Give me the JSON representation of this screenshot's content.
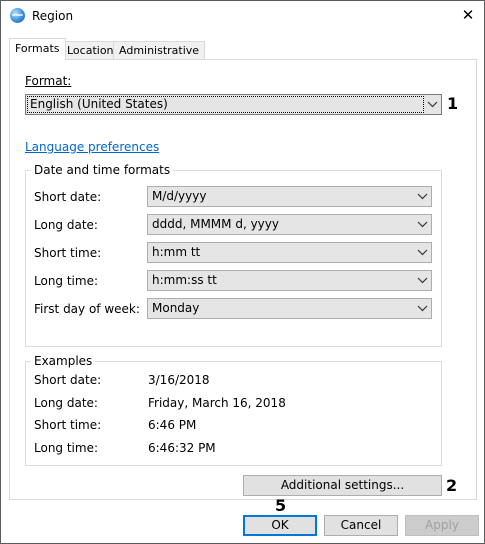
{
  "window": {
    "title": "Region",
    "icon": "globe-icon",
    "close_glyph": "✕"
  },
  "tabs": [
    {
      "label": "Formats",
      "active": true
    },
    {
      "label": "Location",
      "active": false
    },
    {
      "label": "Administrative",
      "active": false
    }
  ],
  "format": {
    "label": "Format:",
    "value": "English (United States)"
  },
  "language_link": "Language preferences",
  "date_time": {
    "title": "Date and time formats",
    "rows": [
      {
        "label": "Short date:",
        "value": "M/d/yyyy"
      },
      {
        "label": "Long date:",
        "value": "dddd, MMMM d, yyyy"
      },
      {
        "label": "Short time:",
        "value": "h:mm tt"
      },
      {
        "label": "Long time:",
        "value": "h:mm:ss tt"
      },
      {
        "label": "First day of week:",
        "value": "Monday"
      }
    ]
  },
  "examples": {
    "title": "Examples",
    "rows": [
      {
        "label": "Short date:",
        "value": "3/16/2018"
      },
      {
        "label": "Long date:",
        "value": "Friday, March 16, 2018"
      },
      {
        "label": "Short time:",
        "value": "6:46 PM"
      },
      {
        "label": "Long time:",
        "value": "6:46:32 PM"
      }
    ]
  },
  "buttons": {
    "additional_settings": "Additional settings...",
    "ok": "OK",
    "cancel": "Cancel",
    "apply": "Apply"
  },
  "markers": {
    "format": "1",
    "additional": "2",
    "ok": "5"
  },
  "colors": {
    "link": "#0066cc",
    "focus_border": "#0078d7",
    "disabled_text": "#a0a0a0"
  }
}
